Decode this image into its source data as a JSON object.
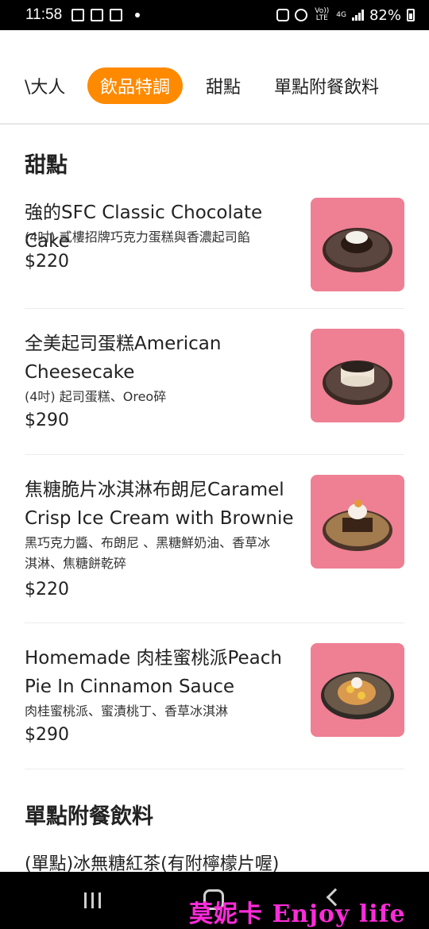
{
  "status_bar": {
    "time": "11:58",
    "left_icons": [
      "calendar-icon",
      "gift-icon",
      "news-icon"
    ],
    "volte": "Vo)) LTE",
    "network": "4G",
    "battery": "82%"
  },
  "tabs": [
    {
      "label": "\\大人",
      "active": false
    },
    {
      "label": "飲品特調",
      "active": true
    },
    {
      "label": "甜點",
      "active": false
    },
    {
      "label": "單點附餐飲料",
      "active": false
    }
  ],
  "accent_color": "#ff8a00",
  "sections": [
    {
      "title": "甜點",
      "items": [
        {
          "name_lines": [
            "強的SFC Classic Chocolate Cake"
          ],
          "desc_lines": [
            "(4吋) 貳樓招牌巧克力蛋糕與香濃起司餡"
          ],
          "price": "$220",
          "image": "chocolate-cake-photo"
        },
        {
          "name_lines": [
            "全美起司蛋糕American",
            "Cheesecake"
          ],
          "desc_lines": [
            "(4吋) 起司蛋糕、Oreo碎"
          ],
          "price": "$290",
          "image": "cheesecake-photo"
        },
        {
          "name_lines": [
            "焦糖脆片冰淇淋布朗尼Caramel",
            "Crisp Ice Cream with Brownie"
          ],
          "desc_lines": [
            "黑巧克力醬、布朗尼 、黑糖鮮奶油、香草冰",
            "淇淋、焦糖餅乾碎"
          ],
          "price": "$220",
          "image": "brownie-photo"
        },
        {
          "name_lines": [
            "Homemade 肉桂蜜桃派Peach",
            "Pie In Cinnamon Sauce"
          ],
          "desc_lines": [
            "肉桂蜜桃派、蜜漬桃丁、香草冰淇淋"
          ],
          "price": "$290",
          "image": "peach-pie-photo"
        }
      ]
    },
    {
      "title": "單點附餐飲料",
      "items": [
        {
          "name_lines": [
            "(單點)冰無糖紅茶(有附檸檬片喔)"
          ]
        }
      ]
    }
  ],
  "watermark": "莫妮卡 Enjoy life"
}
